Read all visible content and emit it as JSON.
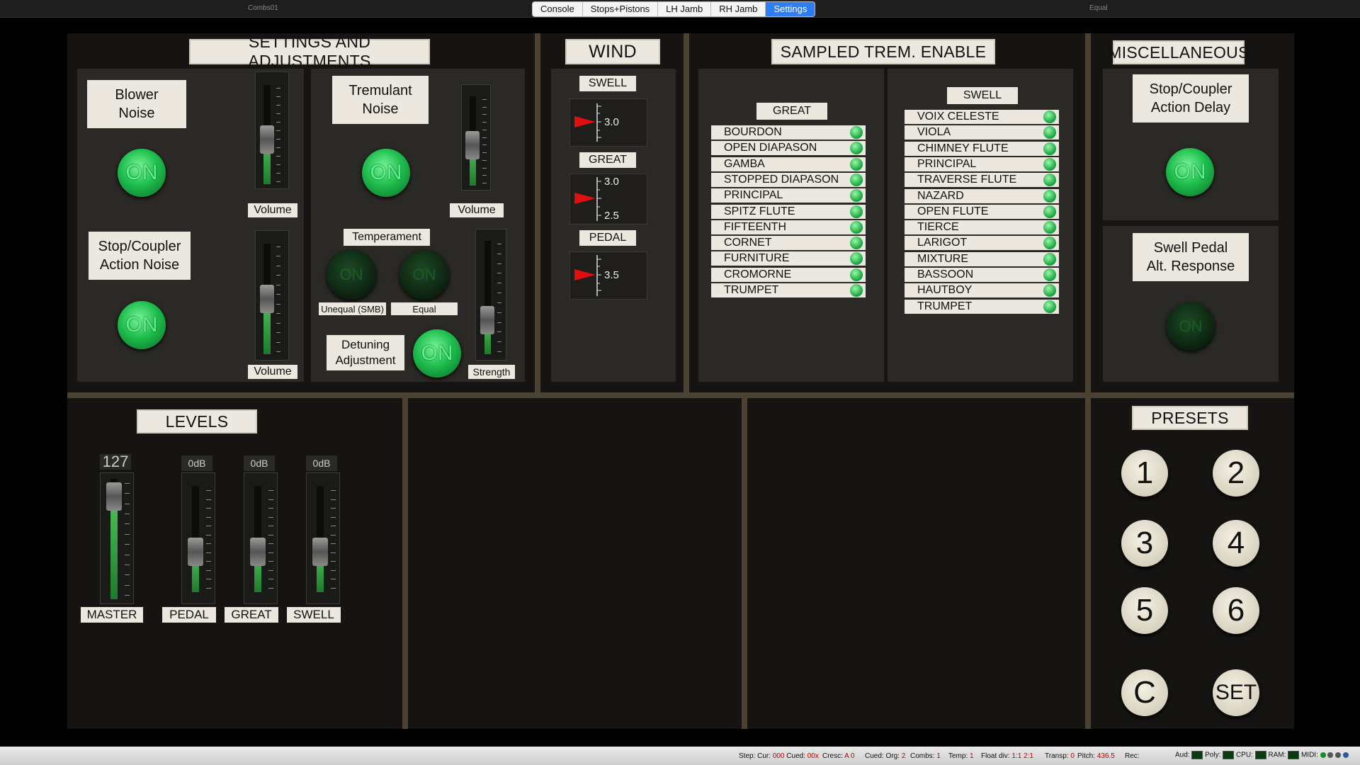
{
  "topbar": {
    "left_label": "Combs01",
    "right_label": "Equal",
    "tabs": [
      "Console",
      "Stops+Pistons",
      "LH Jamb",
      "RH Jamb",
      "Settings"
    ]
  },
  "settings": {
    "title": "SETTINGS AND ADJUSTMENTS",
    "blower": {
      "label": "Blower Noise",
      "state": "ON",
      "slider_label": "Volume",
      "level": 0.45
    },
    "tremulant": {
      "label": "Tremulant Noise",
      "state": "ON",
      "slider_label": "Volume",
      "level": 0.45
    },
    "stopcoupler": {
      "label": "Stop/Coupler Action Noise",
      "state": "ON",
      "slider_label": "Volume",
      "level": 0.5
    },
    "temperament": {
      "label": "Temperament",
      "opt1": "Unequal (SMB)",
      "opt2": "Equal",
      "off_text": "ON"
    },
    "detuning": {
      "label": "Detuning Adjustment",
      "state": "ON",
      "slider_label": "Strength",
      "level": 0.3
    }
  },
  "wind": {
    "title": "WIND",
    "swell": {
      "label": "SWELL",
      "value": "3.0"
    },
    "great": {
      "label": "GREAT",
      "value_top": "3.0",
      "value_bottom": "2.5"
    },
    "pedal": {
      "label": "PEDAL",
      "value": "3.5"
    }
  },
  "trem": {
    "title": "SAMPLED TREM. ENABLE",
    "great_label": "GREAT",
    "great_stops": [
      "BOURDON",
      "OPEN DIAPASON",
      "GAMBA",
      "STOPPED DIAPASON",
      "PRINCIPAL",
      "SPITZ FLUTE",
      "FIFTEENTH",
      "CORNET",
      "FURNITURE",
      "CROMORNE",
      "TRUMPET"
    ],
    "swell_label": "SWELL",
    "swell_stops": [
      "VOIX CELESTE",
      "VIOLA",
      "CHIMNEY FLUTE",
      "PRINCIPAL",
      "TRAVERSE FLUTE",
      "NAZARD",
      "OPEN FLUTE",
      "TIERCE",
      "LARIGOT",
      "MIXTURE",
      "BASSOON",
      "HAUTBOY",
      "TRUMPET"
    ]
  },
  "misc": {
    "title": "MISCELLANEOUS",
    "delay": {
      "label": "Stop/Coupler Action Delay",
      "state": "ON"
    },
    "swellpedal": {
      "label": "Swell Pedal Alt. Response",
      "off_text": "ON"
    }
  },
  "levels": {
    "title": "LEVELS",
    "channels": [
      {
        "name": "MASTER",
        "value": "127",
        "level": 0.85
      },
      {
        "name": "PEDAL",
        "value": "0dB",
        "level": 0.38
      },
      {
        "name": "GREAT",
        "value": "0dB",
        "level": 0.38
      },
      {
        "name": "SWELL",
        "value": "0dB",
        "level": 0.38
      }
    ]
  },
  "presets": {
    "title": "PRESETS",
    "buttons": [
      "1",
      "2",
      "3",
      "4",
      "5",
      "6",
      "C",
      "SET"
    ]
  },
  "status": {
    "step_label": "Step: Cur:",
    "step_cur": "000",
    "cued_label": "Cued:",
    "cued_val": "00x",
    "cresc_label": "Cresc:",
    "cresc_val": "A 0",
    "cued_org_label": "Cued: Org:",
    "cued_org_val": "2",
    "combs_label": "Combs:",
    "combs_val": "1",
    "temp_label": "Temp:",
    "temp_val": "1",
    "float_label": "Float div:",
    "float_val": "1:1 2:1",
    "transp_label": "Transp:",
    "transp_val": "0",
    "pitch_label": "Pitch:",
    "pitch_val": "436.5",
    "rec_label": "Rec:",
    "aud_label": "Aud:",
    "poly_label": "Poly:",
    "cpu_label": "CPU:",
    "ram_label": "RAM:",
    "midi_label": "MIDI:"
  }
}
